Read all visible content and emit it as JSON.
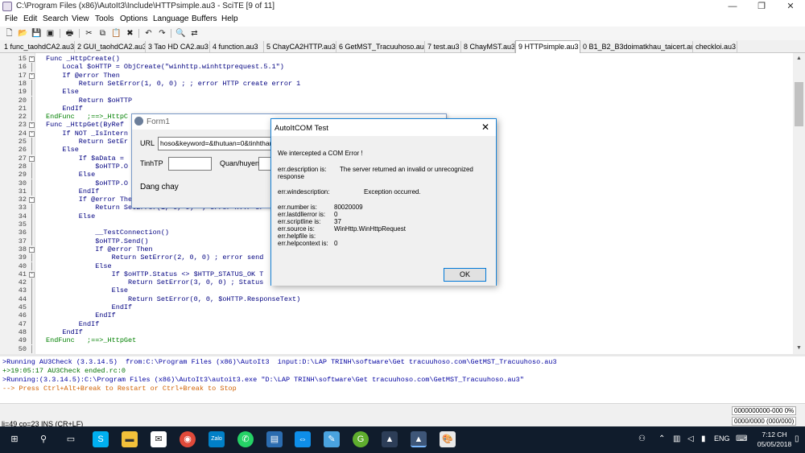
{
  "window": {
    "title": "C:\\Program Files (x86)\\AutoIt3\\Include\\HTTPsimple.au3 - SciTE [9 of 11]",
    "minimize": "—",
    "restore": "❐",
    "close": "✕"
  },
  "menu": [
    "File",
    "Edit",
    "Search",
    "View",
    "Tools",
    "Options",
    "Language",
    "Buffers",
    "Help"
  ],
  "toolbar_icons": [
    "new-file-icon",
    "open-folder-icon",
    "save-icon",
    "save-as-icon",
    "print-icon",
    "cut-icon",
    "copy-icon",
    "paste-icon",
    "delete-icon",
    "undo-icon",
    "redo-icon",
    "find-icon",
    "replace-icon"
  ],
  "tabs": [
    {
      "label": "1 func_taohdCA2.au3",
      "active": false
    },
    {
      "label": "2 GUI_taohdCA2.au3",
      "active": false
    },
    {
      "label": "3 Tao HD CA2.au3",
      "active": false
    },
    {
      "label": "4 function.au3",
      "active": false
    },
    {
      "label": "5 ChayCA2HTTP.au3",
      "active": false
    },
    {
      "label": "6 GetMST_Tracuuhoso.au3",
      "active": false
    },
    {
      "label": "7 test.au3",
      "active": false
    },
    {
      "label": "8 ChayMST.au3",
      "active": false
    },
    {
      "label": "9 HTTPsimple.au3",
      "active": true
    },
    {
      "label": "0 B1_B2_B3doimatkhau_taicert.au3",
      "active": false
    },
    {
      "label": "checkloi.au3",
      "active": false
    }
  ],
  "editor": {
    "lines": [
      {
        "n": "15",
        "fold": "-",
        "text": "Func _HttpCreate()"
      },
      {
        "n": "16",
        "fold": "",
        "text": "    Local $oHTTP = ObjCreate(\"winhttp.winhttprequest.5.1\")"
      },
      {
        "n": "17",
        "fold": "-",
        "text": "    If @error Then"
      },
      {
        "n": "18",
        "fold": "",
        "text": "        Return SetError(1, 0, 0) ; ; error HTTP create error 1"
      },
      {
        "n": "19",
        "fold": "",
        "text": "    Else"
      },
      {
        "n": "20",
        "fold": "",
        "text": "        Return $oHTTP"
      },
      {
        "n": "21",
        "fold": "",
        "text": "    EndIf"
      },
      {
        "n": "22",
        "fold": "",
        "text": "EndFunc   ;==>_HttpC"
      },
      {
        "n": "23",
        "fold": "-",
        "text": "Func _HttpGet(ByRef"
      },
      {
        "n": "24",
        "fold": "-",
        "text": "    If NOT _IsIntern"
      },
      {
        "n": "25",
        "fold": "",
        "text": "        Return SetEr"
      },
      {
        "n": "26",
        "fold": "",
        "text": "    Else"
      },
      {
        "n": "27",
        "fold": "-",
        "text": "        If $aData ="
      },
      {
        "n": "28",
        "fold": "",
        "text": "            $oHTTP.O"
      },
      {
        "n": "29",
        "fold": "",
        "text": "        Else"
      },
      {
        "n": "30",
        "fold": "",
        "text": "            $oHTTP.O"
      },
      {
        "n": "31",
        "fold": "",
        "text": "        EndIf"
      },
      {
        "n": "32",
        "fold": "-",
        "text": "        If @error Then"
      },
      {
        "n": "33",
        "fold": "",
        "text": "            Return SetError(1, 0, 0)  ; error HTTP er"
      },
      {
        "n": "34",
        "fold": "",
        "text": "        Else"
      },
      {
        "n": "35",
        "fold": "",
        "text": ""
      },
      {
        "n": "36",
        "fold": "",
        "text": "            __TestConnection()"
      },
      {
        "n": "37",
        "fold": "",
        "text": "            $oHTTP.Send()"
      },
      {
        "n": "38",
        "fold": "-",
        "text": "            If @error Then"
      },
      {
        "n": "39",
        "fold": "",
        "text": "                Return SetError(2, 0, 0) ; error send"
      },
      {
        "n": "40",
        "fold": "",
        "text": "            Else"
      },
      {
        "n": "41",
        "fold": "-",
        "text": "                If $oHTTP.Status <> $HTTP_STATUS_OK T"
      },
      {
        "n": "42",
        "fold": "",
        "text": "                    Return SetError(3, 0, 0) ; Status"
      },
      {
        "n": "43",
        "fold": "",
        "text": "                Else"
      },
      {
        "n": "44",
        "fold": "",
        "text": "                    Return SetError(0, 0, $oHTTP.ResponseText)"
      },
      {
        "n": "45",
        "fold": "",
        "text": "                EndIf"
      },
      {
        "n": "46",
        "fold": "",
        "text": "            EndIf"
      },
      {
        "n": "47",
        "fold": "",
        "text": "        EndIf"
      },
      {
        "n": "48",
        "fold": "",
        "text": "    EndIf"
      },
      {
        "n": "49",
        "fold": "",
        "text": "EndFunc   ;==>_HttpGet"
      },
      {
        "n": "50",
        "fold": "",
        "text": ""
      }
    ]
  },
  "output": [
    {
      "text": ">Running AU3Check (3.3.14.5)  from:C:\\Program Files (x86)\\AutoIt3  input:D:\\LAP TRINH\\software\\Get tracuuhoso.com\\GetMST_Tracuuhoso.au3",
      "color": "#0000a0"
    },
    {
      "text": "+>19:05:17 AU3Check ended.rc:0",
      "color": "#007000"
    },
    {
      "text": ">Running:(3.3.14.5):C:\\Program Files (x86)\\AutoIt3\\autoit3.exe \"D:\\LAP TRINH\\software\\Get tracuuhoso.com\\GetMST_Tracuuhoso.au3\"",
      "color": "#0000a0"
    },
    {
      "text": "--> Press Ctrl+Alt+Break to Restart or Ctrl+Break to Stop",
      "color": "#d06000"
    }
  ],
  "status": {
    "left": "li=49 co=23 INS (CR+LF)",
    "box1": "0000000000-000 0%",
    "box2": "0000/0000 (000/000)"
  },
  "form1": {
    "title": "Form1",
    "url_label": "URL",
    "url_value": "hoso&keyword=&thutuan=0&tinhthanh=",
    "tinhtp_label": "TinhTP",
    "tinhtp_value": "",
    "quanhuyen_label": "Quan/huyen",
    "quanhuyen_value": "",
    "status_text": "Dang chay"
  },
  "com_dialog": {
    "title": "AutoItCOM Test",
    "close": "✕",
    "heading": "We intercepted a COM Error !",
    "desc_label": "err.description is:",
    "desc_value": "The server returned an invalid or unrecognized",
    "desc_value2": "response",
    "windesc_label": "err.windescription:",
    "windesc_value": "Exception occurred.",
    "number_label": "err.number is:",
    "number_value": "80020009",
    "lastdll_label": "err.lastdllerror is:",
    "lastdll_value": "0",
    "scriptline_label": "err.scriptline is:",
    "scriptline_value": "37",
    "source_label": "err.source is:",
    "source_value": "WinHttp.WinHttpRequest",
    "helpfile_label": "err.helpfile is:",
    "helpfile_value": "",
    "helpcontext_label": "err.helpcontext is:",
    "helpcontext_value": "0",
    "ok_label": "OK"
  },
  "taskbar": {
    "icons": [
      "windows-start-icon",
      "search-icon",
      "task-view-icon",
      "skype-icon",
      "file-explorer-icon",
      "mail-icon",
      "chrome-icon",
      "zalo-icon",
      "whatsapp-icon",
      "image-viewer-icon",
      "teamviewer-icon",
      "feather-icon",
      "greenshot-icon",
      "autoit-icon",
      "autoit-active-icon",
      "paint-icon"
    ],
    "lang": "ENG",
    "time": "7:12 CH",
    "date": "05/05/2018"
  },
  "colors": {
    "keyword": "#000080",
    "comment": "#008000",
    "dialog_border": "#1883d7",
    "taskbar": "#101c2c"
  }
}
